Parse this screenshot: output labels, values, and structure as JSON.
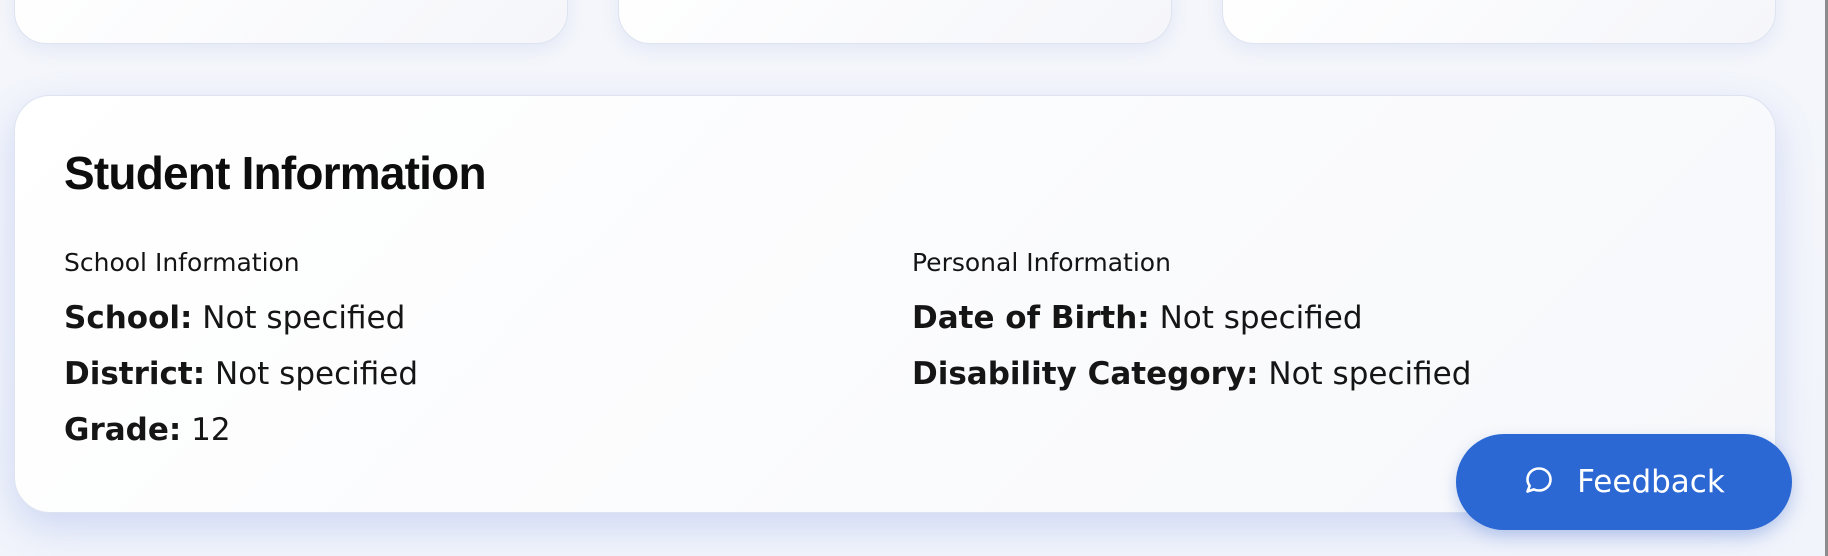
{
  "student_card": {
    "title": "Student Information",
    "school_section": {
      "heading": "School Information",
      "fields": [
        {
          "label": "School:",
          "value": "Not specified"
        },
        {
          "label": "District:",
          "value": "Not specified"
        },
        {
          "label": "Grade:",
          "value": "12"
        }
      ]
    },
    "personal_section": {
      "heading": "Personal Information",
      "fields": [
        {
          "label": "Date of Birth:",
          "value": "Not specified"
        },
        {
          "label": "Disability Category:",
          "value": "Not specified"
        }
      ]
    }
  },
  "feedback_button": {
    "label": "Feedback",
    "icon": "chat-bubble-icon",
    "color": "#2b68d4"
  },
  "colors": {
    "background": "#f3f5fb",
    "card_border": "#dde3f0",
    "accent": "#2b68d4"
  }
}
